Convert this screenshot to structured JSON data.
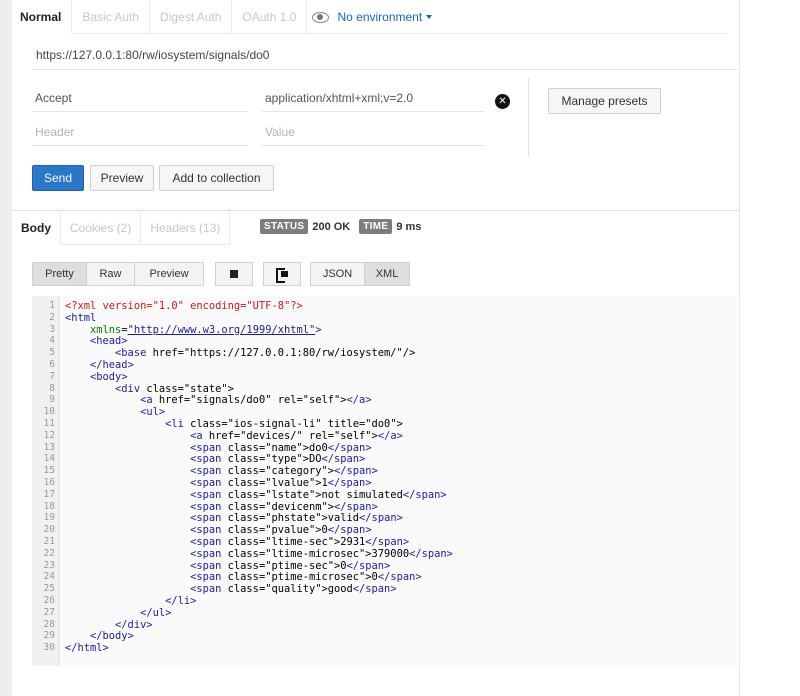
{
  "auth_tabs": [
    "Normal",
    "Basic Auth",
    "Digest Auth",
    "OAuth 1.0"
  ],
  "environment": "No environment",
  "url": "https://127.0.0.1:80/rw/iosystem/signals/do0",
  "headers": [
    {
      "key": "Accept",
      "value": "application/xhtml+xml;v=2.0"
    }
  ],
  "header_placeholder": {
    "key": "Header",
    "value": "Value"
  },
  "buttons": {
    "manage_presets": "Manage presets",
    "send": "Send",
    "preview": "Preview",
    "add_to_collection": "Add to collection"
  },
  "response_tabs": [
    "Body",
    "Cookies (2)",
    "Headers (13)"
  ],
  "status": {
    "status_label": "STATUS",
    "status_value": "200 OK",
    "time_label": "TIME",
    "time_value": "9 ms"
  },
  "view_buttons": {
    "pretty": "Pretty",
    "raw": "Raw",
    "preview": "Preview",
    "json": "JSON",
    "xml": "XML"
  },
  "icons": [
    "eye-icon",
    "remove-header-icon",
    "stop-icon",
    "copy-icon"
  ],
  "colors": {
    "send": "#2a77c9",
    "env_link": "#1a61c7",
    "tag": "#1a1aa6",
    "attr": "#008000",
    "string": "#c41a16"
  },
  "code_lines": [
    "<?xml version=\"1.0\" encoding=\"UTF-8\"?>",
    "<html",
    "    xmlns=\"http://www.w3.org/1999/xhtml\">",
    "    <head>",
    "        <base href=\"https://127.0.0.1:80/rw/iosystem/\"/>",
    "    </head>",
    "    <body>",
    "        <div class=\"state\">",
    "            <a href=\"signals/do0\" rel=\"self\"></a>",
    "            <ul>",
    "                <li class=\"ios-signal-li\" title=\"do0\">",
    "                    <a href=\"devices/\" rel=\"self\"></a>",
    "                    <span class=\"name\">do0</span>",
    "                    <span class=\"type\">DO</span>",
    "                    <span class=\"category\"></span>",
    "                    <span class=\"lvalue\">1</span>",
    "                    <span class=\"lstate\">not simulated</span>",
    "                    <span class=\"devicenm\"></span>",
    "                    <span class=\"phstate\">valid</span>",
    "                    <span class=\"pvalue\">0</span>",
    "                    <span class=\"ltime-sec\">2931</span>",
    "                    <span class=\"ltime-microsec\">379000</span>",
    "                    <span class=\"ptime-sec\">0</span>",
    "                    <span class=\"ptime-microsec\">0</span>",
    "                    <span class=\"quality\">good</span>",
    "                </li>",
    "            </ul>",
    "        </div>",
    "    </body>",
    "</html>"
  ]
}
